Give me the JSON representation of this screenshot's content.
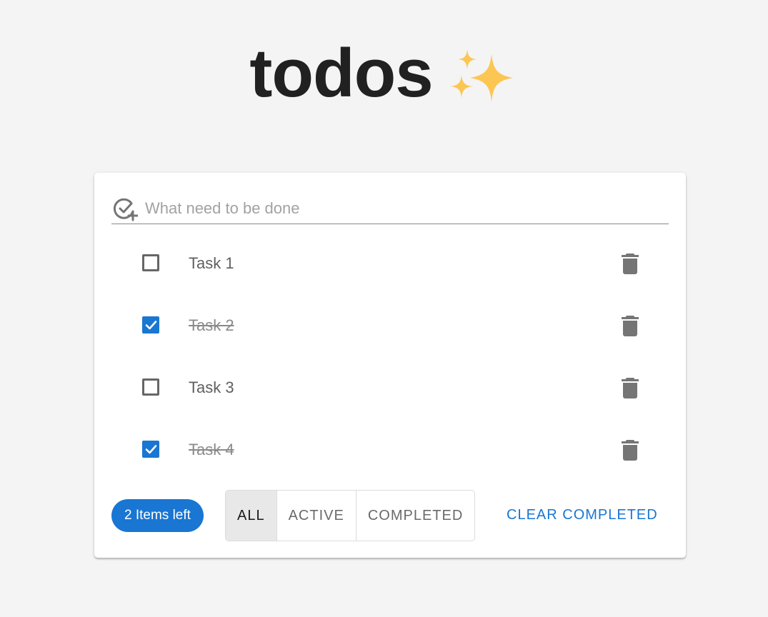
{
  "header": {
    "title": "todos",
    "title_icon": "sparkles-icon",
    "sparkle_color": "#fcc653"
  },
  "new_todo": {
    "icon": "add-task-icon",
    "placeholder": "What need to be done",
    "value": ""
  },
  "todos": [
    {
      "text": "Task 1",
      "completed": false
    },
    {
      "text": "Task 2",
      "completed": true
    },
    {
      "text": "Task 3",
      "completed": false
    },
    {
      "text": "Task 4",
      "completed": true
    }
  ],
  "footer": {
    "items_left_label": "2 Items left",
    "filters": [
      {
        "label": "ALL",
        "selected": true
      },
      {
        "label": "ACTIVE",
        "selected": false
      },
      {
        "label": "COMPLETED",
        "selected": false
      }
    ],
    "clear_completed_label": "CLEAR COMPLETED"
  },
  "colors": {
    "accent": "#1976d2",
    "background": "#f4f4f4",
    "icon_gray": "#757575"
  }
}
